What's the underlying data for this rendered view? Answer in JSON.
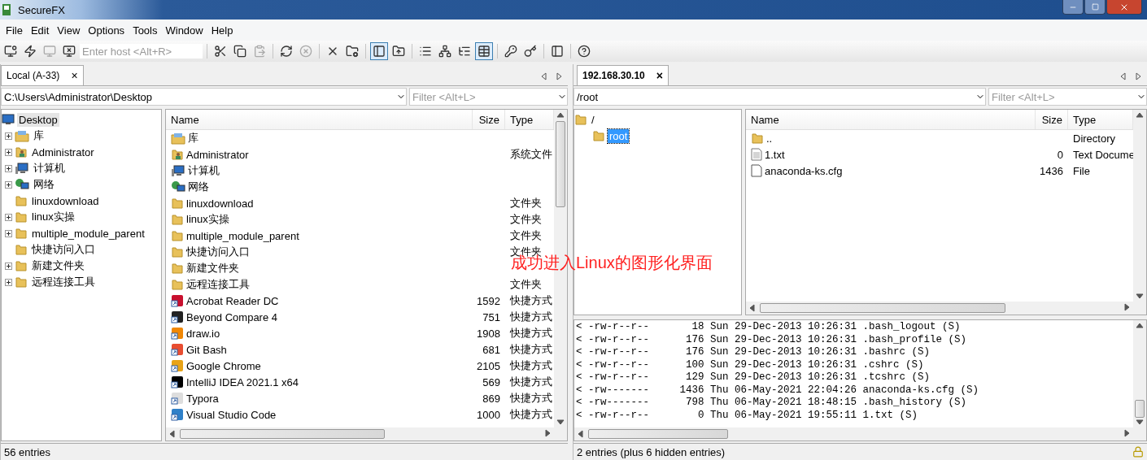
{
  "window": {
    "title": "SecureFX"
  },
  "menu": [
    "File",
    "Edit",
    "View",
    "Options",
    "Tools",
    "Window",
    "Help"
  ],
  "toolbar": {
    "host_placeholder": "Enter host <Alt+R>",
    "groups": [
      [
        {
          "pressed": false,
          "disabled": false
        },
        {
          "pressed": false,
          "disabled": false
        },
        {
          "pressed": false,
          "disabled": true
        },
        {
          "pressed": false,
          "disabled": false
        }
      ],
      [
        {
          "pressed": false,
          "disabled": false
        },
        {
          "pressed": false,
          "disabled": false
        },
        {
          "pressed": false,
          "disabled": true
        }
      ],
      [
        {
          "pressed": false,
          "disabled": false
        },
        {
          "pressed": false,
          "disabled": true
        }
      ],
      [
        {
          "pressed": false,
          "disabled": false
        },
        {
          "pressed": false,
          "disabled": false
        }
      ],
      [
        {
          "pressed": true,
          "disabled": false
        },
        {
          "pressed": false,
          "disabled": false
        }
      ],
      [
        {
          "pressed": false,
          "disabled": false
        },
        {
          "pressed": false,
          "disabled": false
        },
        {
          "pressed": false,
          "disabled": false
        },
        {
          "pressed": true,
          "disabled": false
        }
      ],
      [
        {
          "pressed": false,
          "disabled": false
        },
        {
          "pressed": false,
          "disabled": false
        }
      ],
      [
        {
          "pressed": false,
          "disabled": false
        }
      ],
      [
        {
          "pressed": false,
          "disabled": false
        }
      ]
    ]
  },
  "left_pane": {
    "tabs": [
      {
        "label": "Local (A-33)",
        "close": "×",
        "selected": true
      }
    ],
    "path": "C:\\Users\\Administrator\\Desktop",
    "filter_placeholder": "Filter <Alt+L>",
    "tree": [
      {
        "label": "Desktop",
        "kind": "desktop",
        "selected": true,
        "children": [
          {
            "label": "库",
            "kind": "library",
            "has_children": true,
            "selected": false
          },
          {
            "label": "Administrator",
            "kind": "user-folder",
            "has_children": true,
            "selected": false
          },
          {
            "label": "计算机",
            "kind": "computer",
            "has_children": true,
            "selected": false
          },
          {
            "label": "网络",
            "kind": "network",
            "has_children": true,
            "selected": false
          },
          {
            "label": "linuxdownload",
            "kind": "folder",
            "has_children": false,
            "selected": false
          },
          {
            "label": "linux实操",
            "kind": "folder",
            "has_children": true,
            "selected": false
          },
          {
            "label": "multiple_module_parent",
            "kind": "folder",
            "has_children": true,
            "selected": false
          },
          {
            "label": "快捷访问入口",
            "kind": "folder",
            "has_children": false,
            "selected": false
          },
          {
            "label": "新建文件夹",
            "kind": "folder",
            "has_children": true,
            "selected": false
          },
          {
            "label": "远程连接工具",
            "kind": "folder",
            "has_children": true,
            "selected": false
          }
        ]
      }
    ],
    "columns": [
      "Name",
      "Size",
      "Type"
    ],
    "rows": [
      {
        "name": "库",
        "kind": "library",
        "size": "",
        "type": ""
      },
      {
        "name": "Administrator",
        "kind": "user-folder",
        "size": "",
        "type": "系统文件"
      },
      {
        "name": "计算机",
        "kind": "computer",
        "size": "",
        "type": ""
      },
      {
        "name": "网络",
        "kind": "network",
        "size": "",
        "type": ""
      },
      {
        "name": "linuxdownload",
        "kind": "folder",
        "size": "",
        "type": "文件夹"
      },
      {
        "name": "linux实操",
        "kind": "folder",
        "size": "",
        "type": "文件夹"
      },
      {
        "name": "multiple_module_parent",
        "kind": "folder",
        "size": "",
        "type": "文件夹"
      },
      {
        "name": "快捷访问入口",
        "kind": "folder",
        "size": "",
        "type": "文件夹"
      },
      {
        "name": "新建文件夹",
        "kind": "folder",
        "size": "",
        "type": ""
      },
      {
        "name": "远程连接工具",
        "kind": "folder",
        "size": "",
        "type": "文件夹"
      },
      {
        "name": "Acrobat Reader DC",
        "kind": "shortcut",
        "color": "#c8102e",
        "size": "1592",
        "type": "快捷方式"
      },
      {
        "name": "Beyond Compare 4",
        "kind": "shortcut",
        "color": "#222222",
        "size": "751",
        "type": "快捷方式"
      },
      {
        "name": "draw.io",
        "kind": "shortcut",
        "color": "#f08705",
        "size": "1908",
        "type": "快捷方式"
      },
      {
        "name": "Git Bash",
        "kind": "shortcut",
        "color": "#e84d31",
        "size": "681",
        "type": "快捷方式"
      },
      {
        "name": "Google Chrome",
        "kind": "shortcut",
        "color": "#e8a317",
        "size": "2105",
        "type": "快捷方式"
      },
      {
        "name": "IntelliJ IDEA 2021.1 x64",
        "kind": "shortcut",
        "color": "#000000",
        "size": "569",
        "type": "快捷方式"
      },
      {
        "name": "Typora",
        "kind": "shortcut",
        "color": "#dddddd",
        "size": "869",
        "type": "快捷方式"
      },
      {
        "name": "Visual Studio Code",
        "kind": "shortcut",
        "color": "#2f80c8",
        "size": "1000",
        "type": "快捷方式"
      }
    ],
    "status": "56 entries"
  },
  "right_pane": {
    "tabs": [
      {
        "label": "192.168.30.10",
        "close": "×",
        "selected": true
      }
    ],
    "path": "/root",
    "filter_placeholder": "Filter <Alt+L>",
    "tree": [
      {
        "label": "/",
        "kind": "folder",
        "selected": false,
        "children": [
          {
            "label": "root",
            "kind": "folder",
            "selected": true
          }
        ]
      }
    ],
    "columns": [
      "Name",
      "Size",
      "Type"
    ],
    "rows": [
      {
        "name": "..",
        "kind": "folder",
        "size": "",
        "type": "Directory"
      },
      {
        "name": "1.txt",
        "kind": "text-file",
        "size": "0",
        "type": "Text Docume"
      },
      {
        "name": "anaconda-ks.cfg",
        "kind": "file",
        "size": "1436",
        "type": "File"
      }
    ],
    "log": [
      "< -rw-r--r--       18 Sun 29-Dec-2013 10:26:31 .bash_logout (S)",
      "< -rw-r--r--      176 Sun 29-Dec-2013 10:26:31 .bash_profile (S)",
      "< -rw-r--r--      176 Sun 29-Dec-2013 10:26:31 .bashrc (S)",
      "< -rw-r--r--      100 Sun 29-Dec-2013 10:26:31 .cshrc (S)",
      "< -rw-r--r--      129 Sun 29-Dec-2013 10:26:31 .tcshrc (S)",
      "< -rw-------     1436 Thu 06-May-2021 22:04:26 anaconda-ks.cfg (S)",
      "< -rw-------      798 Thu 06-May-2021 18:48:15 .bash_history (S)",
      "< -rw-r--r--        0 Thu 06-May-2021 19:55:11 1.txt (S)"
    ],
    "status": "2 entries (plus 6 hidden entries)"
  },
  "annotation": "成功进入Linux的图形化界面"
}
